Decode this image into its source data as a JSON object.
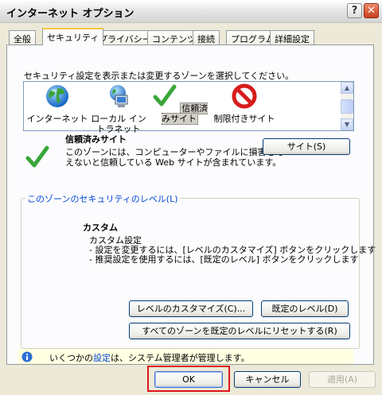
{
  "window": {
    "title": "インターネット オプション",
    "help_label": "?",
    "close_label": "✕"
  },
  "tabs": [
    {
      "label": "全般"
    },
    {
      "label": "セキュリティ"
    },
    {
      "label": "プライバシー"
    },
    {
      "label": "コンテンツ"
    },
    {
      "label": "接続"
    },
    {
      "label": "プログラム"
    },
    {
      "label": "詳細設定"
    }
  ],
  "active_tab": "セキュリティ",
  "security": {
    "instruction": "セキュリティ設定を表示または変更するゾーンを選択してください。",
    "zones": [
      {
        "label": "インターネット",
        "icon": "globe-icon"
      },
      {
        "label": "ローカル イントラネット",
        "icon": "intranet-computer-icon"
      },
      {
        "label": "信頼済みサイト",
        "icon": "checkmark-icon",
        "selected": true
      },
      {
        "label": "制限付きサイト",
        "icon": "restricted-icon"
      }
    ],
    "zone_detail": {
      "name": "信頼済みサイト",
      "description_line1": "このゾーンには、コンピューターやファイルに損害を与",
      "description_line2": "えないと信頼している Web サイトが含まれています。",
      "sites_button": "サイト(S)"
    },
    "level_group": {
      "title": "このゾーンのセキュリティのレベル(L)",
      "level_name": "カスタム",
      "line1": "カスタム設定",
      "line2": "- 設定を変更するには、[レベルのカスタマイズ] ボタンをクリックします",
      "line3": "- 推奨設定を使用するには、[既定のレベル] ボタンをクリックします",
      "custom_button": "レベルのカスタマイズ(C)...",
      "default_button": "既定のレベル(D)"
    },
    "reset_all_button": "すべてのゾーンを既定のレベルにリセットする(R)",
    "info": {
      "before": "いくつかの",
      "link": "設定",
      "after": "は、システム管理者が管理します。"
    }
  },
  "footer": {
    "ok": "OK",
    "cancel": "キャンセル",
    "apply": "適用(A)"
  },
  "colors": {
    "accent_highlight": "#e0141e",
    "tab_hot": "#ffc83c",
    "link": "#0046d5",
    "info_bg": "#ffffe1"
  }
}
